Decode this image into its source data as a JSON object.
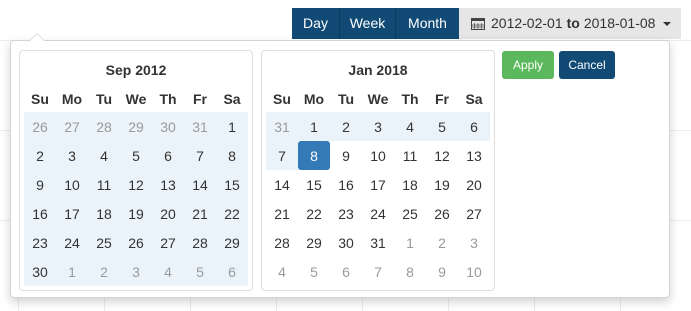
{
  "toolbar": {
    "day_label": "Day",
    "week_label": "Week",
    "month_label": "Month",
    "range_start": "2012-02-01",
    "range_to": "to",
    "range_end": "2018-01-08"
  },
  "buttons": {
    "apply": "Apply",
    "cancel": "Cancel"
  },
  "colors": {
    "navy": "#114a74",
    "apply_green": "#5cb85c",
    "selected": "#337ab7",
    "range_bg": "#eaf3f9"
  },
  "weekdays": [
    "Su",
    "Mo",
    "Tu",
    "We",
    "Th",
    "Fr",
    "Sa"
  ],
  "left_calendar": {
    "title": "Sep 2012",
    "weeks": [
      [
        "26",
        "27",
        "28",
        "29",
        "30",
        "31",
        "1"
      ],
      [
        "2",
        "3",
        "4",
        "5",
        "6",
        "7",
        "8"
      ],
      [
        "9",
        "10",
        "11",
        "12",
        "13",
        "14",
        "15"
      ],
      [
        "16",
        "17",
        "18",
        "19",
        "20",
        "21",
        "22"
      ],
      [
        "23",
        "24",
        "25",
        "26",
        "27",
        "28",
        "29"
      ],
      [
        "30",
        "1",
        "2",
        "3",
        "4",
        "5",
        "6"
      ]
    ]
  },
  "right_calendar": {
    "title": "Jan 2018",
    "weeks": [
      [
        "31",
        "1",
        "2",
        "3",
        "4",
        "5",
        "6"
      ],
      [
        "7",
        "8",
        "9",
        "10",
        "11",
        "12",
        "13"
      ],
      [
        "14",
        "15",
        "16",
        "17",
        "18",
        "19",
        "20"
      ],
      [
        "21",
        "22",
        "23",
        "24",
        "25",
        "26",
        "27"
      ],
      [
        "28",
        "29",
        "30",
        "31",
        "1",
        "2",
        "3"
      ],
      [
        "4",
        "5",
        "6",
        "7",
        "8",
        "9",
        "10"
      ]
    ]
  }
}
